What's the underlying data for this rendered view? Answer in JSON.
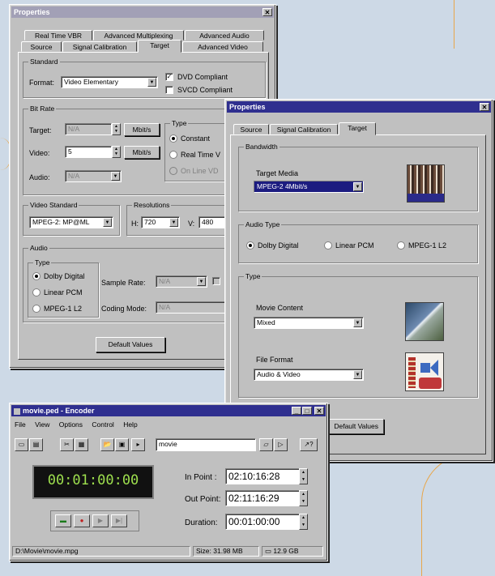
{
  "props1": {
    "title": "Properties",
    "close": "✕",
    "tabs_row1": [
      "Real Time VBR",
      "Advanced Multiplexing",
      "Advanced Audio"
    ],
    "tabs_row2": [
      "Source",
      "Signal Calibration",
      "Target",
      "Advanced Video"
    ],
    "standard_label": "Standard",
    "format_label": "Format:",
    "format_value": "Video Elementary",
    "dvd_label": "DVD Compliant",
    "svcd_label": "SVCD Compliant",
    "dvd_check": "✓",
    "bitrate_label": "Bit Rate",
    "target_label": "Target:",
    "target_value": "N/A",
    "video_label": "Video:",
    "video_value": "5",
    "audio_label": "Audio:",
    "audio_value": "N/A",
    "mbps": "Mbit/s",
    "type_label": "Type",
    "constant": "Constant",
    "realtime": "Real Time V",
    "online": "On Line VD",
    "video_standard_label": "Video Standard",
    "video_standard_value": "MPEG-2: MP@ML",
    "resolutions_label": "Resolutions",
    "h_label": "H:",
    "h_value": "720",
    "v_label": "V:",
    "v_value": "480",
    "audio_group": "Audio",
    "audio_type": "Type",
    "dolby": "Dolby Digital",
    "lpcm": "Linear PCM",
    "mpeg": "MPEG-1 L2",
    "sample_rate_label": "Sample Rate:",
    "sample_rate_value": "N/A",
    "coding_mode_label": "Coding Mode:",
    "coding_mode_value": "N/A",
    "default_values": "Default Values"
  },
  "props2": {
    "title": "Properties",
    "close": "✕",
    "tabs": [
      "Source",
      "Signal Calibration",
      "Target"
    ],
    "bandwidth_label": "Bandwidth",
    "target_media_label": "Target Media",
    "target_media_value": "MPEG-2 4Mbit/s",
    "audio_type_label": "Audio Type",
    "dolby": "Dolby Digital",
    "lpcm": "Linear PCM",
    "mpeg": "MPEG-1 L2",
    "type_label": "Type",
    "movie_content_label": "Movie Content",
    "movie_content_value": "Mixed",
    "file_format_label": "File Format",
    "file_format_value": "Audio & Video",
    "default_values": "Default Values"
  },
  "encoder": {
    "title": "movie.ped - Encoder",
    "menu": [
      "File",
      "View",
      "Options",
      "Control",
      "Help"
    ],
    "name_field": "movie",
    "help_btn": "↗?",
    "time_display": "00:01:00:00",
    "in_point_label": "In Point :",
    "in_point_value": "02:10:16:28",
    "out_point_label": "Out Point:",
    "out_point_value": "02:11:16:29",
    "duration_label": "Duration:",
    "duration_value": "00:01:00:00",
    "status_path": "D:\\Movie\\movie.mpg",
    "status_size": "Size: 31.98 MB",
    "status_free": "12.9 GB"
  }
}
